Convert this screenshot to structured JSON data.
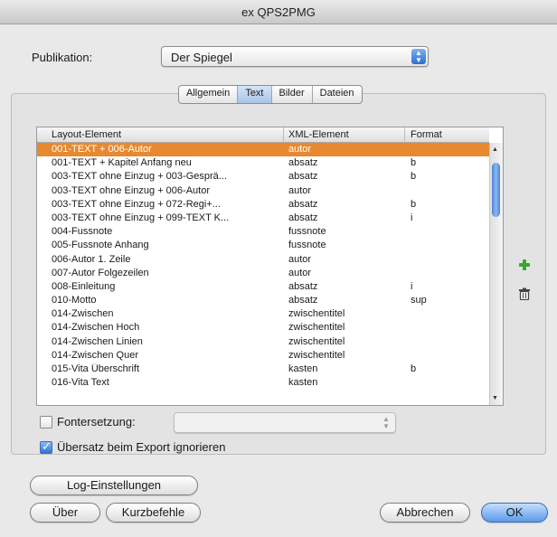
{
  "window": {
    "title": "ex QPS2PMG"
  },
  "publication": {
    "label": "Publikation:",
    "value": "Der Spiegel"
  },
  "tabs": [
    {
      "label": "Allgemein"
    },
    {
      "label": "Text"
    },
    {
      "label": "Bilder"
    },
    {
      "label": "Dateien"
    }
  ],
  "table": {
    "headers": [
      "Layout-Element",
      "XML-Element",
      "Format"
    ],
    "rows": [
      {
        "layout": "001-TEXT  +  006-Autor",
        "xml": "autor",
        "format": ""
      },
      {
        "layout": "001-TEXT  +  Kapitel Anfang neu",
        "xml": "absatz",
        "format": "b"
      },
      {
        "layout": "003-TEXT ohne Einzug  +  003-Gesprä...",
        "xml": "absatz",
        "format": "b"
      },
      {
        "layout": "003-TEXT ohne Einzug  +  006-Autor",
        "xml": "autor",
        "format": ""
      },
      {
        "layout": "003-TEXT ohne Einzug  +  072-Regi+...",
        "xml": "absatz",
        "format": "b"
      },
      {
        "layout": "003-TEXT ohne Einzug  +  099-TEXT K...",
        "xml": "absatz",
        "format": "i"
      },
      {
        "layout": "004-Fussnote",
        "xml": "fussnote",
        "format": ""
      },
      {
        "layout": "005-Fussnote Anhang",
        "xml": "fussnote",
        "format": ""
      },
      {
        "layout": "006-Autor 1. Zeile",
        "xml": "autor",
        "format": ""
      },
      {
        "layout": "007-Autor Folgezeilen",
        "xml": "autor",
        "format": ""
      },
      {
        "layout": "008-Einleitung",
        "xml": "absatz",
        "format": "i"
      },
      {
        "layout": "010-Motto",
        "xml": "absatz",
        "format": "sup"
      },
      {
        "layout": "014-Zwischen",
        "xml": "zwischentitel",
        "format": ""
      },
      {
        "layout": "014-Zwischen Hoch",
        "xml": "zwischentitel",
        "format": ""
      },
      {
        "layout": "014-Zwischen Linien",
        "xml": "zwischentitel",
        "format": ""
      },
      {
        "layout": "014-Zwischen Quer",
        "xml": "zwischentitel",
        "format": ""
      },
      {
        "layout": "015-Vita Überschrift",
        "xml": "kasten",
        "format": "b"
      },
      {
        "layout": "016-Vita Text",
        "xml": "kasten",
        "format": ""
      }
    ]
  },
  "font_replacement": {
    "label": "Fontersetzung:",
    "checked": false
  },
  "overset": {
    "label": "Übersatz beim Export ignorieren",
    "checked": true
  },
  "buttons": {
    "log": "Log-Einstellungen",
    "about": "Über",
    "shortcuts": "Kurzbefehle",
    "cancel": "Abbrechen",
    "ok": "OK"
  },
  "colors": {
    "selection": "#e8892f",
    "accent": "#2c72d6",
    "add_icon": "#3aa52e"
  },
  "icons": [
    "add-icon",
    "trash-icon",
    "chevron-up-down-icon",
    "checkmark-icon"
  ]
}
